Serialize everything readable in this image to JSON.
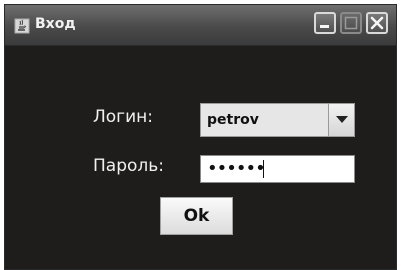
{
  "window": {
    "title": "Вход",
    "app_icon": "java-cup-icon",
    "controls": {
      "minimize": "minimize-icon",
      "maximize": "maximize-icon",
      "close": "close-icon"
    }
  },
  "form": {
    "login_label": "Логин:",
    "login_value": "petrov",
    "password_label": "Пароль:",
    "password_value_masked": "••••••",
    "ok_label": "Ok"
  },
  "colors": {
    "window_bg": "#1f1c1c",
    "title_bar": "#4a4a4a",
    "label_text": "#f0f0f0"
  }
}
